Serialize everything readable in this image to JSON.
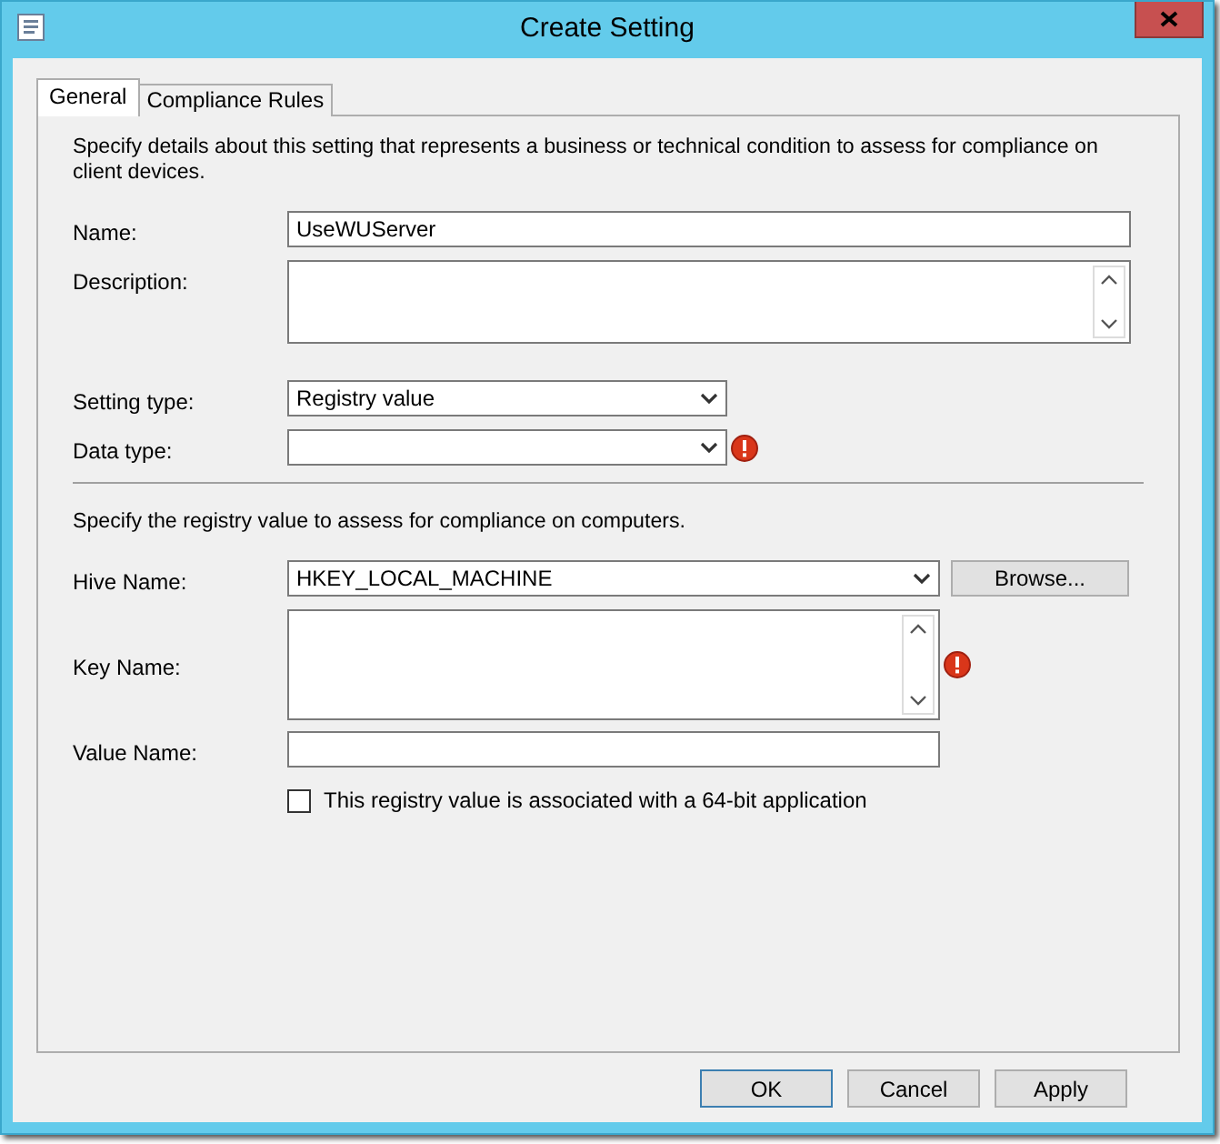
{
  "window": {
    "title": "Create Setting"
  },
  "tabs": [
    {
      "label": "General",
      "selected": true
    },
    {
      "label": "Compliance Rules",
      "selected": false
    }
  ],
  "sections": [
    {
      "intro": "Specify details about this setting that represents a business or technical condition to assess for compliance on client devices.",
      "fields": [
        {
          "label": "Name:",
          "kind": "text",
          "value": "UseWUServer"
        },
        {
          "label": "Description:",
          "kind": "textarea"
        },
        {
          "label": "Setting type:",
          "kind": "select",
          "value": "Registry value"
        },
        {
          "label": "Data type:",
          "kind": "select",
          "error": true
        }
      ]
    },
    {
      "intro": "Specify the registry value to assess for compliance on computers.",
      "fields": [
        {
          "label": "Hive Name:",
          "kind": "select",
          "value": "HKEY_LOCAL_MACHINE",
          "button": "Browse..."
        },
        {
          "label": "Key Name:",
          "kind": "textarea",
          "error": true
        },
        {
          "label": "Value Name:",
          "kind": "text"
        }
      ],
      "checkbox": {
        "label": "This registry value is associated with a 64-bit application",
        "checked": false
      }
    }
  ],
  "buttons": [
    {
      "label": "OK",
      "default": true
    },
    {
      "label": "Cancel",
      "default": false
    },
    {
      "label": "Apply",
      "default": false
    }
  ]
}
